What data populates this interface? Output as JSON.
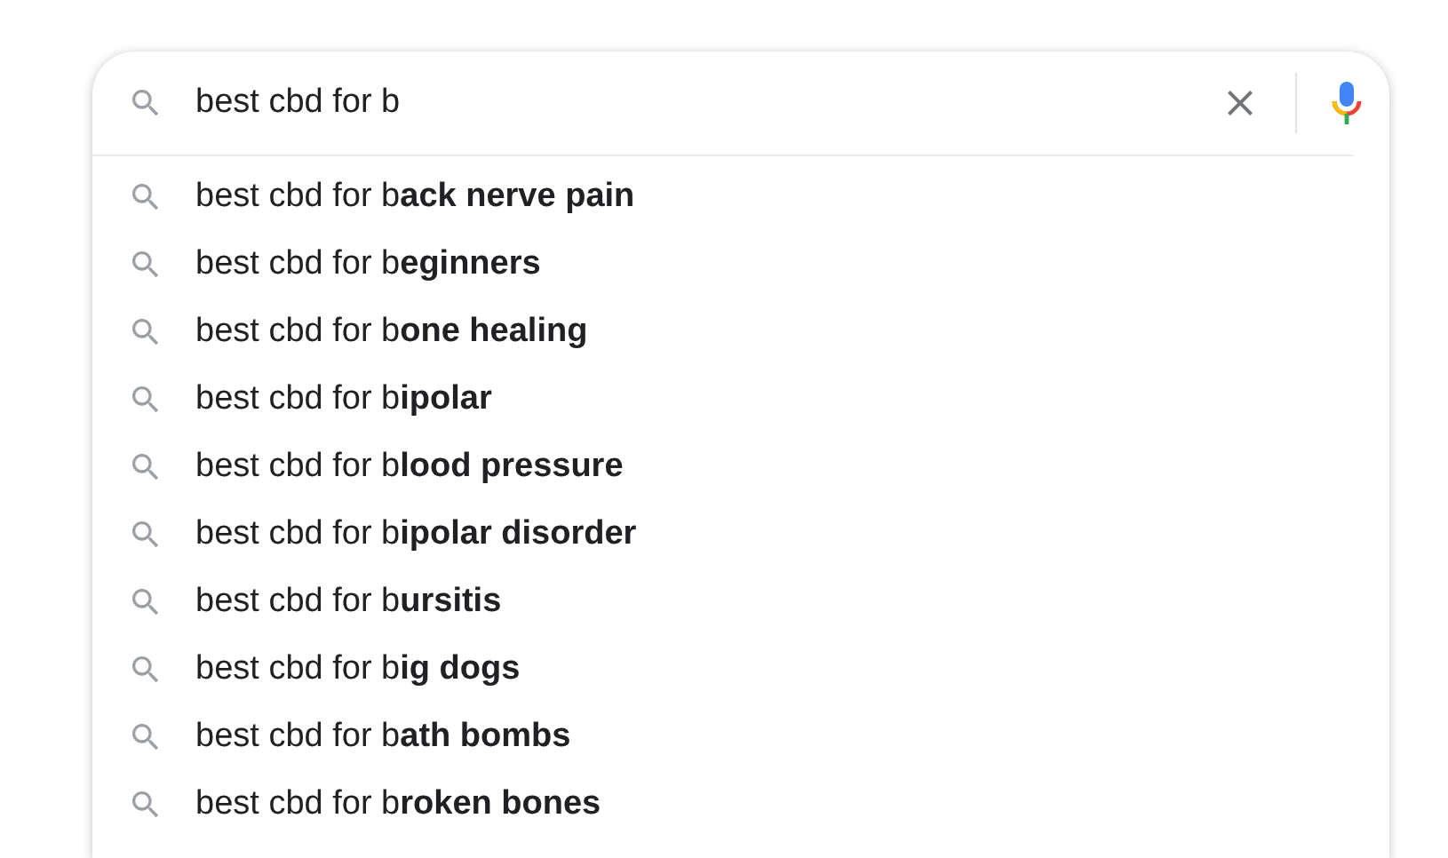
{
  "search": {
    "value": "best cbd for b"
  },
  "suggestions": [
    {
      "text": "best cbd for b**ack nerve pain**"
    },
    {
      "text": "best cbd for b**eginners**"
    },
    {
      "text": "best cbd for b**one healing**"
    },
    {
      "text": "best cbd for b**ipolar**"
    },
    {
      "text": "best cbd for b**lood pressure**"
    },
    {
      "text": "best cbd for b**ipolar disorder**"
    },
    {
      "text": "best cbd for b**ursitis**"
    },
    {
      "text": "best cbd for b**ig dogs**"
    },
    {
      "text": "best cbd for b**ath bombs**"
    },
    {
      "text": "best cbd for b**roken bones**"
    }
  ]
}
